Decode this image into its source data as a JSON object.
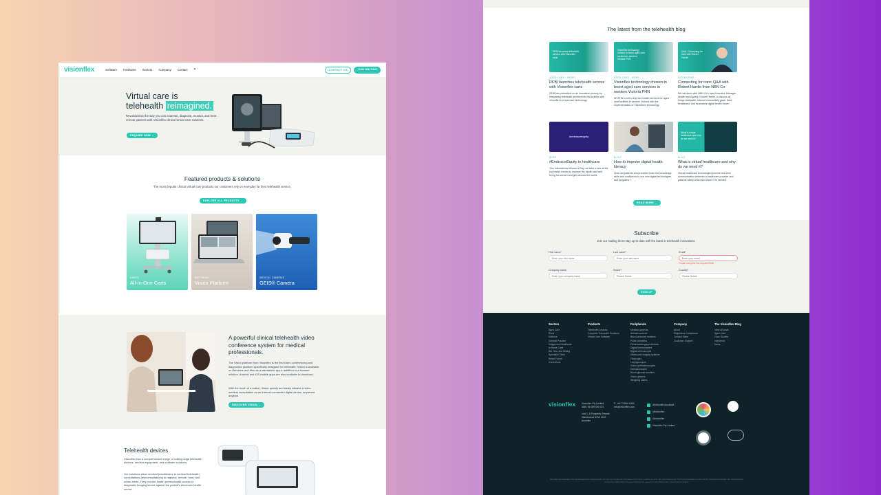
{
  "left": {
    "nav": {
      "logo": "visionflex",
      "links": [
        "Software",
        "Hardware",
        "Sectors",
        "Company",
        "Contact"
      ],
      "btn_outline": "CONTACT US",
      "btn_solid": "JOIN WAITING"
    },
    "hero": {
      "title_line1": "Virtual care is",
      "title_line2a": "telehealth",
      "title_line2b": "reimagined.",
      "body": "Revolutionise the way you can examine, diagnose, monitor, and treat remote patients with Visionflex clinical virtual care solutions.",
      "cta": "ENQUIRE NOW →"
    },
    "featured": {
      "title": "Featured products & solutions",
      "subtitle": "The most popular clinical virtual care products our customers rely on everyday for their telehealth service.",
      "cta": "EXPLORE ALL PRODUCTS →",
      "cards": [
        {
          "tag": "CARTS",
          "title": "All-In-One Carts"
        },
        {
          "tag": "SOFTWARE",
          "title": "Vision Platform"
        },
        {
          "tag": "MEDICAL CAMERAS",
          "title": "GEIS® Camera"
        }
      ]
    },
    "vision": {
      "title": "A powerful clinical telehealth video conference system for medical professionals.",
      "p1": "The Vision platform from Visionflex is the first video conferencing and diagnostics platform specifically designed for telehealth. Vision is available on Windows and Mac as a standalone app in addition to a browser solution. Android and iOS mobile apps are also available to download.",
      "p2": "With the touch of a button, Vision quickly and easily initiates a video medical consultation on an internet-connected digital device, anywhere, anytime.",
      "cta": "DISCOVER VISION →"
    },
    "devices": {
      "title": "Telehealth devices",
      "p1": "Visionflex has a comprehensive range of cutting-edge telehealth devices, medical equipment, and software solutions.",
      "p2": "Our solutions allow medical practitioners to conduct telehealth consultations (teleconsultations) in regional, remote, rural, and urban areas. They provide health professionals access to diagnostic imaging stored against the patient's electronic health record."
    }
  },
  "right": {
    "blog": {
      "title": "The latest from the telehealth blog",
      "posts": [
        {
          "tag": "AGED CARE · NEWS",
          "title": "RFBI launches telehealth service with Visionflex carts",
          "excerpt": "RFBI has embarked on an innovative journey by integrating telehealth services into its facilities with Visionflex's virtual care technology.",
          "img_text": "RFBI launches telehealth service with Visionflex carts"
        },
        {
          "tag": "AGED CARE · NEWS",
          "title": "Visionflex technology chosen to boost aged care services in western Victoria PHN",
          "excerpt": "WVPHN is set to improve health services for aged care facilities in western Victoria with the implementation of Visionflex's technology.",
          "img_text": "Visionflex technology chosen to boost aged care services in western Victoria PHN"
        },
        {
          "tag": "INTERVIEWS",
          "title": "Connecting for care: Q&A with Robert Hardie from NBN Co",
          "excerpt": "We sat down with NBN Co's new Executive Manager Health and Ageing, Robert Hardie, to discuss all things telehealth, internet connectivity gaps, fixed broadband, and Australia's digital health future.",
          "img_text": "Q&A: Connecting for care with Robert Hardie"
        },
        {
          "tag": "BLOG",
          "title": "#EmbraceEquity in healthcare",
          "excerpt": "This International Women's Day, we take a look at the top health checks to improve the health and well-being for women and girls around the world.",
          "img_text": "#embraceequity"
        },
        {
          "tag": "BLOG",
          "title": "How to improve digital health literacy",
          "excerpt": "How can patients and providers learn the knowledge, skills and confidence to use new digital technologies and programs?",
          "img_text": ""
        },
        {
          "tag": "BLOG",
          "title": "What is virtual healthcare and why do we need it?",
          "excerpt": "Virtual healthcare technologies provide real-time communication between a healthcare provider and patients safely when and where it is needed.",
          "img_text": "What is virtual healthcare and why do we need it?"
        }
      ],
      "cta": "READ MORE →"
    },
    "subscribe": {
      "title": "Subscribe",
      "desc": "Join our mailing list to stay up-to-date with the latest in telehealth innovations.",
      "fields": [
        {
          "label": "First name*",
          "placeholder": "Enter your first name"
        },
        {
          "label": "Last name*",
          "placeholder": "Enter your last name"
        },
        {
          "label": "Email*",
          "placeholder": "Enter your email",
          "error": "Please complete this required field."
        },
        {
          "label": "Company name",
          "placeholder": "Enter your company name"
        },
        {
          "label": "Sector*",
          "placeholder": "Please Select"
        },
        {
          "label": "Country*",
          "placeholder": "Please Select"
        }
      ],
      "button": "SIGN UP"
    },
    "footer": {
      "cols": [
        {
          "heading": "Sectors",
          "items": [
            "Aged Care",
            "Rural",
            "Defence",
            "General Practice",
            "Indigenous Healthcare",
            "In Home Care",
            "Ski, Sea, and Mining",
            "Specialist Clinic",
            "Smart Future",
            "Corrections"
          ]
        },
        {
          "heading": "Products",
          "items": [
            "Telehealth Devices",
            "Complete Telehealth Solutions",
            "Virtual Care Software"
          ]
        },
        {
          "heading": "Peripherals",
          "items": [
            "Medical cameras",
            "Animal cameras",
            "Blood pressure monitors",
            "Pulse oximeters",
            "Electrocardiograph devices",
            "Digital thermometers",
            "Digital stethoscopes",
            "Ultrasound imaging systems",
            "Otoscopes",
            "Laryngoscopes",
            "Video ophthalmoscopes",
            "Dermatoscopes",
            "Blood glucose monitors",
            "Vision glasses",
            "Weighing scales"
          ]
        },
        {
          "heading": "Company",
          "items": [
            "About",
            "Regulatory Compliance",
            "Contact Sales",
            "Customer Support"
          ]
        },
        {
          "heading": "The Visionflex Blog",
          "items": [
            "View all posts",
            "Aged Care",
            "Case Studies",
            "Interviews",
            "News"
          ]
        }
      ],
      "logo": "visionflex",
      "company": [
        "Visionflex Pty Limited",
        "ABN: 56 609 095 021"
      ],
      "address": [
        "Unit 1, 8 Prosperity Parade",
        "Warriewood NSW 2102",
        "Australia"
      ],
      "phone": "P: +61 2 8916 6300",
      "email": "info@visionflex.com",
      "socials": [
        "@VisionflexAustralia",
        "@visionflex",
        "@visionflex",
        "Visionflex Pty Limited"
      ],
      "ack": "Visionflex acknowledges the Gayamaygal and Garigal people who are the Traditional Custodians of the land on which we work. We acknowledge the Traditional Custodians of the Country throughout Australia. We recognise their continuous relationship to the land and pay our respects to their Elders past, present and emerging."
    }
  }
}
